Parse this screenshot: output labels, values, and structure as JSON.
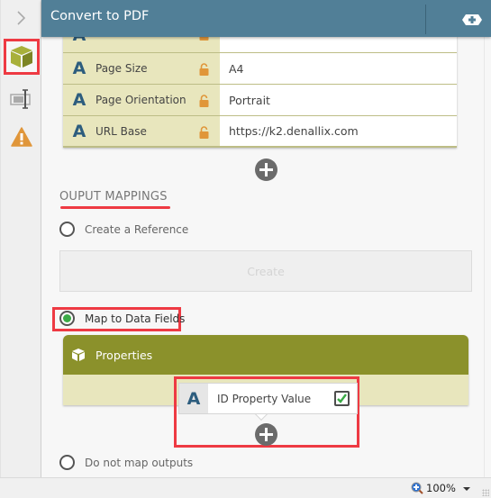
{
  "header": {
    "title": "Convert to PDF",
    "add_button_icon": "add-tag-icon"
  },
  "rail": {
    "items": [
      {
        "name": "collapse",
        "icon": "chevron-right-icon"
      },
      {
        "name": "object",
        "icon": "cube-icon",
        "selected": true
      },
      {
        "name": "field",
        "icon": "text-field-icon"
      },
      {
        "name": "warnings",
        "icon": "warning-icon"
      }
    ]
  },
  "input_properties": [
    {
      "label": "",
      "value": "",
      "icon": "text-type-icon",
      "locked": true
    },
    {
      "label": "Page Size",
      "value": "A4",
      "icon": "text-type-icon",
      "locked": true
    },
    {
      "label": "Page Orientation",
      "value": "Portrait",
      "icon": "text-type-icon",
      "locked": true
    },
    {
      "label": "URL Base",
      "value": "https://k2.denallix.com",
      "icon": "text-type-icon",
      "locked": true
    }
  ],
  "type_glyph": "A",
  "output_mappings": {
    "title": "OUPUT MAPPINGS",
    "options": [
      {
        "label": "Create a Reference",
        "selected": false
      },
      {
        "label": "Map to Data Fields",
        "selected": true
      },
      {
        "label": "Do not map outputs",
        "selected": false
      }
    ],
    "create_button": "Create",
    "properties_panel": {
      "title": "Properties",
      "items": [
        {
          "label": "ID Property Value",
          "checked": true
        }
      ]
    }
  },
  "footer": {
    "zoom": "100%"
  },
  "colors": {
    "header": "#517f97",
    "olive": "#8b912b",
    "olive_light": "#e8e6bd",
    "highlight": "#ee3a43",
    "radio_on": "#3aaa46",
    "lock": "#e0963a"
  }
}
